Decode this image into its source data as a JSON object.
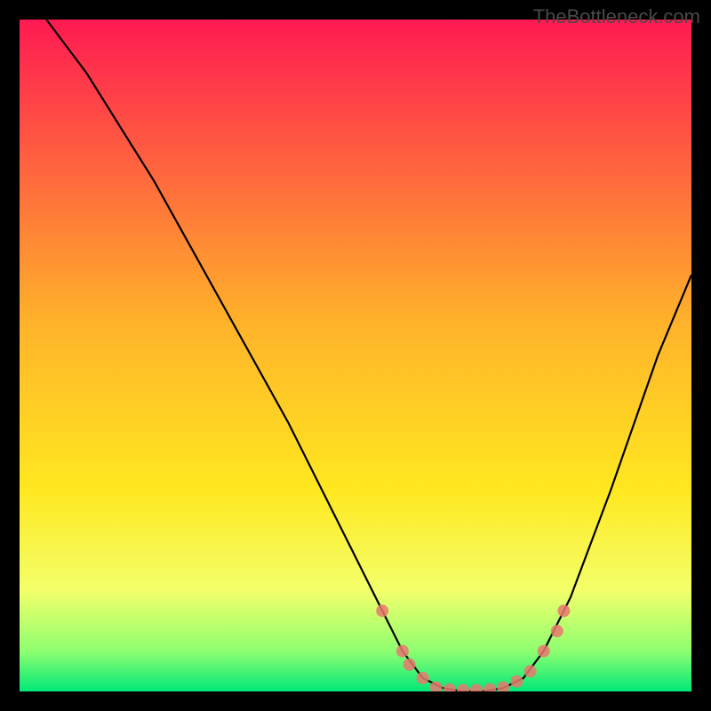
{
  "watermark": "TheBottleneck.com",
  "chart_data": {
    "type": "line",
    "title": "",
    "xlabel": "",
    "ylabel": "",
    "xlim": [
      0,
      100
    ],
    "ylim": [
      0,
      100
    ],
    "curve": [
      {
        "x": 4,
        "y": 100
      },
      {
        "x": 10,
        "y": 92
      },
      {
        "x": 20,
        "y": 76
      },
      {
        "x": 30,
        "y": 58
      },
      {
        "x": 40,
        "y": 40
      },
      {
        "x": 50,
        "y": 20
      },
      {
        "x": 54,
        "y": 12
      },
      {
        "x": 57,
        "y": 6
      },
      {
        "x": 60,
        "y": 2
      },
      {
        "x": 63,
        "y": 0.5
      },
      {
        "x": 66,
        "y": 0
      },
      {
        "x": 69,
        "y": 0
      },
      {
        "x": 72,
        "y": 0.5
      },
      {
        "x": 75,
        "y": 2
      },
      {
        "x": 78,
        "y": 6
      },
      {
        "x": 82,
        "y": 14
      },
      {
        "x": 88,
        "y": 30
      },
      {
        "x": 95,
        "y": 50
      },
      {
        "x": 100,
        "y": 62
      }
    ],
    "markers": [
      {
        "x": 54,
        "y": 12
      },
      {
        "x": 57,
        "y": 6
      },
      {
        "x": 58,
        "y": 4
      },
      {
        "x": 60,
        "y": 2
      },
      {
        "x": 62,
        "y": 0.6
      },
      {
        "x": 64,
        "y": 0.3
      },
      {
        "x": 66,
        "y": 0.2
      },
      {
        "x": 68,
        "y": 0.2
      },
      {
        "x": 70,
        "y": 0.3
      },
      {
        "x": 72,
        "y": 0.6
      },
      {
        "x": 74,
        "y": 1.5
      },
      {
        "x": 76,
        "y": 3
      },
      {
        "x": 78,
        "y": 6
      },
      {
        "x": 80,
        "y": 9
      },
      {
        "x": 81,
        "y": 12
      }
    ],
    "gradient_stops": [
      {
        "offset": 0,
        "color": "#ff1a52"
      },
      {
        "offset": 45,
        "color": "#ffb22a"
      },
      {
        "offset": 70,
        "color": "#ffe820"
      },
      {
        "offset": 85,
        "color": "#f3ff6a"
      },
      {
        "offset": 94,
        "color": "#8eff70"
      },
      {
        "offset": 100,
        "color": "#00e878"
      }
    ]
  }
}
